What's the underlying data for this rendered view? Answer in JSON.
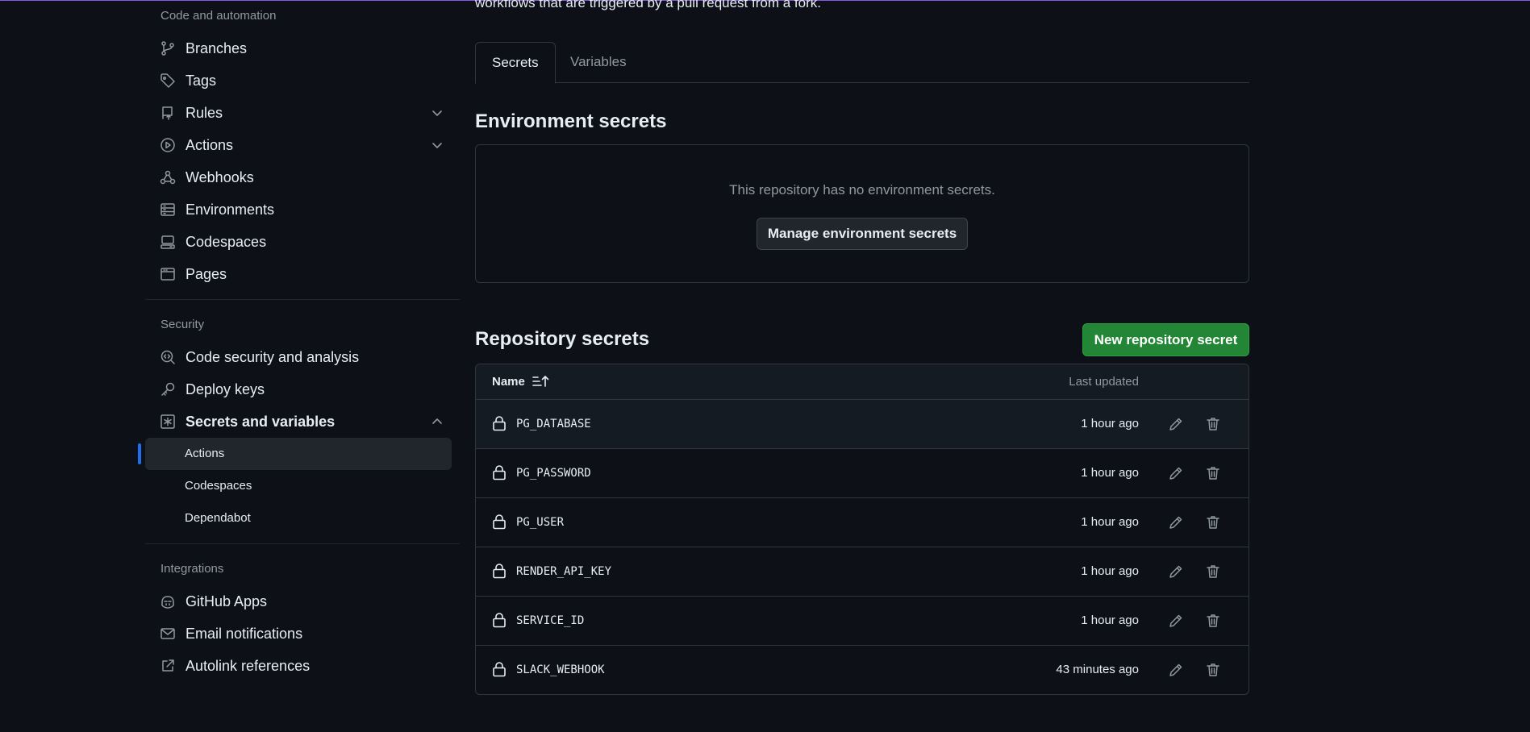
{
  "sidebar": {
    "code_heading": "Code and automation",
    "code_items": [
      {
        "label": "Branches",
        "icon": "git-branch-icon"
      },
      {
        "label": "Tags",
        "icon": "tag-icon"
      },
      {
        "label": "Rules",
        "icon": "repo-push-icon",
        "expandable": true
      },
      {
        "label": "Actions",
        "icon": "play-icon",
        "expandable": true
      },
      {
        "label": "Webhooks",
        "icon": "webhook-icon"
      },
      {
        "label": "Environments",
        "icon": "server-icon"
      },
      {
        "label": "Codespaces",
        "icon": "codespaces-icon"
      },
      {
        "label": "Pages",
        "icon": "browser-icon"
      }
    ],
    "security_heading": "Security",
    "security_items": [
      {
        "label": "Code security and analysis",
        "icon": "codescan-icon"
      },
      {
        "label": "Deploy keys",
        "icon": "key-icon"
      },
      {
        "label": "Secrets and variables",
        "icon": "asterisk-icon",
        "expanded": true
      }
    ],
    "secrets_sub_items": [
      {
        "label": "Actions",
        "active": true
      },
      {
        "label": "Codespaces"
      },
      {
        "label": "Dependabot"
      }
    ],
    "integrations_heading": "Integrations",
    "integrations_items": [
      {
        "label": "GitHub Apps",
        "icon": "copilot-icon"
      },
      {
        "label": "Email notifications",
        "icon": "mail-icon"
      },
      {
        "label": "Autolink references",
        "icon": "link-external-icon"
      }
    ]
  },
  "main": {
    "intro_text": "workflows that are triggered by a pull request from a fork.",
    "tabs": [
      {
        "label": "Secrets",
        "selected": true
      },
      {
        "label": "Variables"
      }
    ],
    "env_secrets": {
      "heading": "Environment secrets",
      "empty_message": "This repository has no environment secrets.",
      "manage_button": "Manage environment secrets"
    },
    "repo_secrets": {
      "heading": "Repository secrets",
      "new_button": "New repository secret",
      "columns": {
        "name": "Name",
        "updated": "Last updated"
      },
      "rows": [
        {
          "name": "PG_DATABASE",
          "updated": "1 hour ago"
        },
        {
          "name": "PG_PASSWORD",
          "updated": "1 hour ago"
        },
        {
          "name": "PG_USER",
          "updated": "1 hour ago"
        },
        {
          "name": "RENDER_API_KEY",
          "updated": "1 hour ago"
        },
        {
          "name": "SERVICE_ID",
          "updated": "1 hour ago"
        },
        {
          "name": "SLACK_WEBHOOK",
          "updated": "43 minutes ago"
        }
      ]
    }
  },
  "colors": {
    "background": "#0d1117",
    "accent_blue": "#1f6feb",
    "primary_green": "#238636",
    "muted_text": "#9198a1"
  }
}
